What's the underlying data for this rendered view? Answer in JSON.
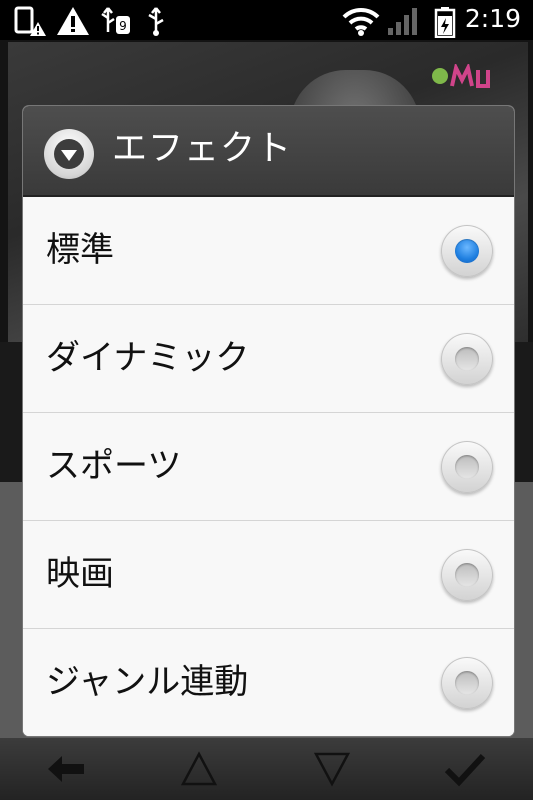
{
  "status_bar": {
    "time": "2:19",
    "icons": [
      "sim-alert-icon",
      "warning-icon",
      "usb-debug-icon",
      "usb-icon",
      "wifi-icon",
      "signal-icon",
      "battery-charging-icon"
    ]
  },
  "dialog": {
    "title": "エフェクト",
    "options": [
      {
        "label": "標準",
        "selected": true
      },
      {
        "label": "ダイナミック",
        "selected": false
      },
      {
        "label": "スポーツ",
        "selected": false
      },
      {
        "label": "映画",
        "selected": false
      },
      {
        "label": "ジャンル連動",
        "selected": false
      }
    ]
  },
  "bottom_bar": {
    "icons": [
      "back-arrow-icon",
      "up-triangle-icon",
      "down-triangle-icon",
      "check-icon"
    ]
  },
  "colors": {
    "accent": "#1f7fe0",
    "header_bg": "#444444",
    "list_bg": "#f8f8f8"
  }
}
